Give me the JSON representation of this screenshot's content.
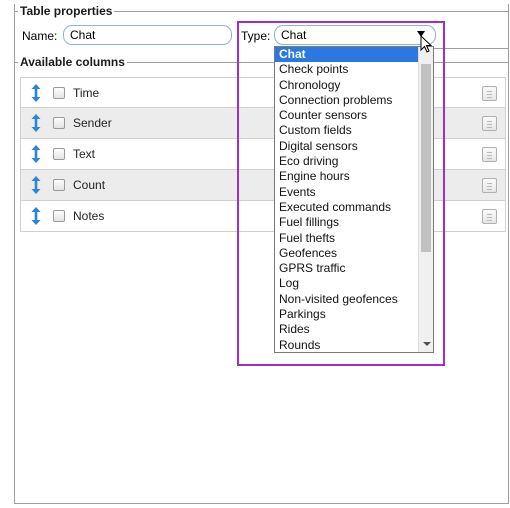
{
  "table_properties": {
    "legend": "Table properties",
    "name_label": "Name:",
    "name_value": "Chat",
    "type_label": "Type:",
    "type_value": "Chat"
  },
  "available_columns": {
    "legend": "Available columns",
    "rows": [
      {
        "label": "Time",
        "checked": false
      },
      {
        "label": "Sender",
        "checked": false
      },
      {
        "label": "Text",
        "checked": false
      },
      {
        "label": "Count",
        "checked": false
      },
      {
        "label": "Notes",
        "checked": false
      }
    ]
  },
  "type_dropdown": {
    "selected": "Chat",
    "options": [
      "Chat",
      "Check points",
      "Chronology",
      "Connection problems",
      "Counter sensors",
      "Custom fields",
      "Digital sensors",
      "Eco driving",
      "Engine hours",
      "Events",
      "Executed commands",
      "Fuel fillings",
      "Fuel thefts",
      "Geofences",
      "GPRS traffic",
      "Log",
      "Non-visited geofences",
      "Parkings",
      "Rides",
      "Rounds"
    ],
    "highlight_color": "#9b2fd1",
    "selected_color": "#2a78e0"
  },
  "icons": {
    "drag": "vertical-resize-arrow-icon",
    "info": "info-icon",
    "dropdown_arrow": "chevron-down-icon",
    "cursor": "mouse-pointer-icon"
  }
}
